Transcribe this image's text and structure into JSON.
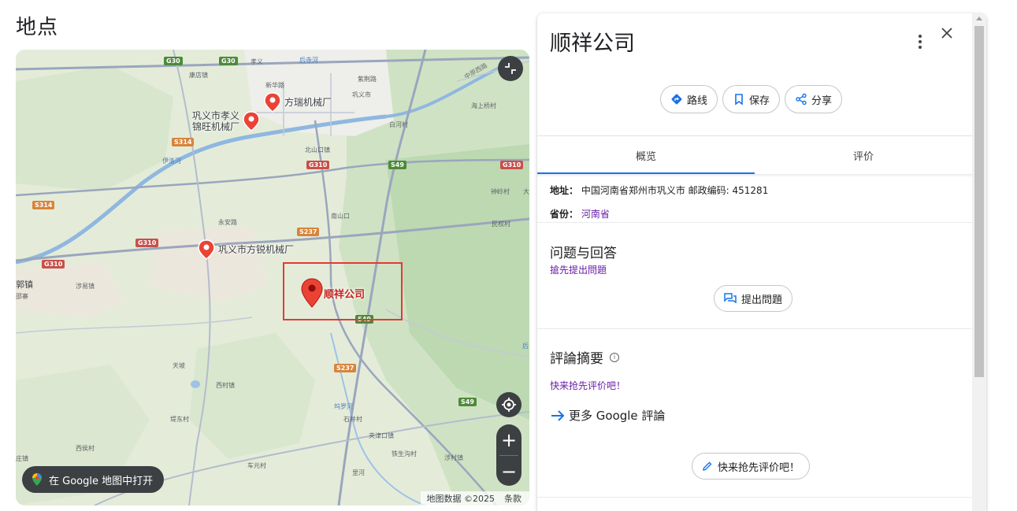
{
  "section": {
    "title": "地点"
  },
  "map": {
    "open_in_maps_label": "在 Google 地图中打开",
    "attribution": "地图数据 ©2025",
    "terms": "条款",
    "zoom_in": "+",
    "zoom_out": "−",
    "selected_place_label": "顺祥公司",
    "pois": [
      {
        "name": "方瑞机械厂"
      },
      {
        "name": "巩义市孝义\n锦旺机械厂"
      },
      {
        "name": "巩义市方锐机械厂"
      }
    ],
    "place_labels": [
      "孝义",
      "后寺河",
      "康店镇",
      "新华路",
      "紫荆路",
      "巩义市",
      "海上桥村",
      "白河村",
      "中原西路",
      "北山口镇",
      "伊洛河",
      "钟岭村",
      "民权村",
      "永安路",
      "南山口",
      "涉易镇",
      "郭镇",
      "邵寨",
      "天坡",
      "西村镇",
      "堤东村",
      "西侯村",
      "庄镇",
      "车元村",
      "坞罗河",
      "石井村",
      "夹津口镇",
      "铁生沟村",
      "涉村镇",
      "里河",
      "大",
      "后"
    ],
    "road_badges": [
      "G30",
      "G30",
      "S314",
      "G310",
      "S49",
      "G310",
      "S314",
      "S237",
      "G310",
      "G310",
      "S49",
      "S237",
      "S49"
    ]
  },
  "panel": {
    "title": "顺祥公司",
    "actions": [
      {
        "label": "路线"
      },
      {
        "label": "保存"
      },
      {
        "label": "分享"
      }
    ],
    "tabs": [
      {
        "label": "概览",
        "active": true
      },
      {
        "label": "评价",
        "active": false
      }
    ],
    "address_key": "地址：",
    "address_value": "中国河南省郑州市巩义市 邮政编码: 451281",
    "province_key": "省份：",
    "province_value": "河南省",
    "qa_title": "问题与回答",
    "qa_link": "搶先提出問題",
    "ask_button": "提出問題",
    "review_summary_title": "評論摘要",
    "review_first_link": "快来抢先评价吧！",
    "more_reviews": "更多 Google 評論",
    "write_review_button": "快来抢先评价吧！"
  },
  "colors": {
    "accent_blue": "#1a73e8",
    "link_purple": "#681da8",
    "pin_red": "#ea4335",
    "highlight_red": "#e53935",
    "map_control_dark": "#3c4043"
  }
}
